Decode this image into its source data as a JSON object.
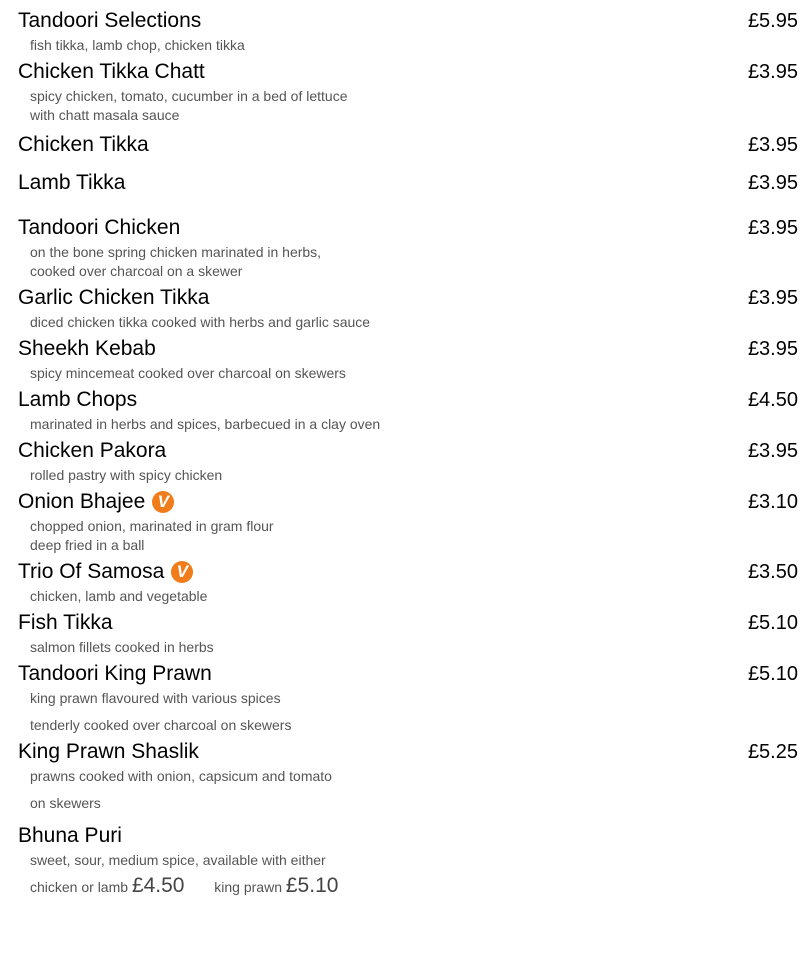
{
  "items": [
    {
      "name": "Tandoori Selections",
      "price": "£5.95",
      "desc1": "fish tikka, lamb chop, chicken tikka"
    },
    {
      "name": "Chicken Tikka Chatt",
      "price": "£3.95",
      "desc1": "spicy chicken, tomato, cucumber in a bed of lettuce",
      "desc2": "with chatt masala sauce"
    },
    {
      "name": "Chicken Tikka",
      "price": "£3.95"
    },
    {
      "name": "Lamb Tikka",
      "price": "£3.95"
    },
    {
      "name": "Tandoori Chicken",
      "price": "£3.95",
      "desc1": "on the bone spring chicken marinated in herbs,",
      "desc2": "cooked over charcoal on a skewer"
    },
    {
      "name": "Garlic Chicken Tikka",
      "price": "£3.95",
      "desc1": "diced chicken tikka cooked with herbs and garlic sauce"
    },
    {
      "name": "Sheekh Kebab",
      "price": "£3.95",
      "desc1": "spicy mincemeat cooked over charcoal on skewers"
    },
    {
      "name": "Lamb Chops",
      "price": "£4.50",
      "desc1": "marinated in herbs and spices, barbecued in a clay oven"
    },
    {
      "name": "Chicken Pakora",
      "price": "£3.95",
      "desc1": "rolled pastry with spicy chicken"
    },
    {
      "name": "Onion Bhajee",
      "veg": "V",
      "price": "£3.10",
      "desc1": "chopped onion, marinated in gram flour",
      "desc2": "deep fried in a ball"
    },
    {
      "name": "Trio Of Samosa",
      "veg": "V",
      "price": "£3.50",
      "desc1": "chicken, lamb and vegetable"
    },
    {
      "name": "Fish Tikka",
      "price": "£5.10",
      "desc1": "salmon fillets cooked in herbs"
    },
    {
      "name": "Tandoori King Prawn",
      "price": "£5.10",
      "desc1": "king prawn flavoured with various spices",
      "desc2": "tenderly cooked over charcoal on skewers"
    },
    {
      "name": "King Prawn Shaslik",
      "price": "£5.25",
      "desc1": "prawns cooked with onion, capsicum and tomato",
      "desc2": "on skewers"
    },
    {
      "name": "Bhuna Puri",
      "desc1": "sweet, sour, medium spice, available with either",
      "desc2_a": "chicken or lamb",
      "desc2_price_a": "£4.50",
      "desc2_b": "king prawn",
      "desc2_price_b": "£5.10"
    }
  ],
  "colors": {
    "veg_badge": "#f07d1a"
  }
}
